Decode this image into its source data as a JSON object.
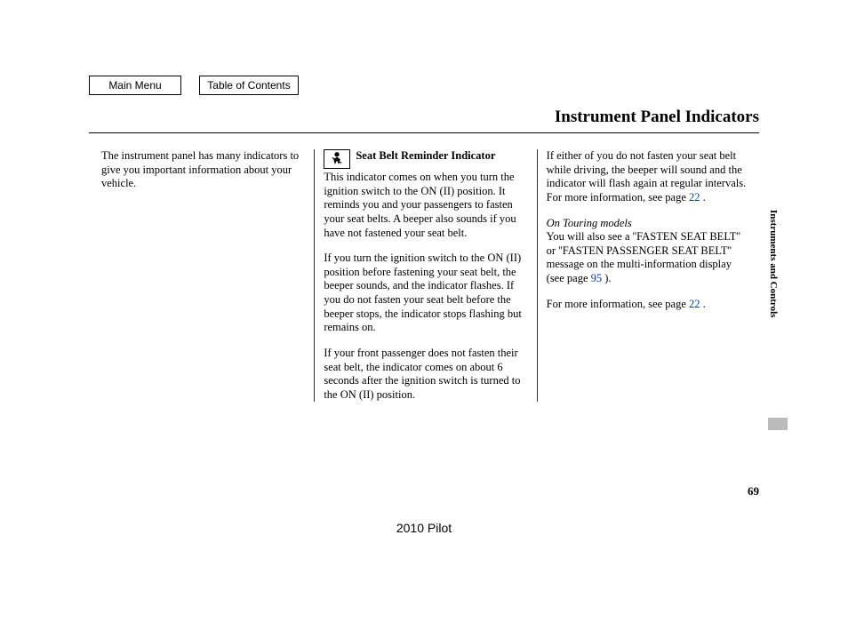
{
  "nav": {
    "main_menu": "Main Menu",
    "toc": "Table of Contents"
  },
  "page_title": "Instrument Panel Indicators",
  "side_label": "Instruments and Controls",
  "page_number": "69",
  "footer_model": "2010 Pilot",
  "col1": {
    "intro": "The instrument panel has many indicators to give you important information about your vehicle."
  },
  "col2": {
    "indicator_title": "Seat Belt Reminder Indicator",
    "p1": "This indicator comes on when you turn the ignition switch to the ON (II) position. It reminds you and your passengers to fasten your seat belts. A beeper also sounds if you have not fastened your seat belt.",
    "p2": "If you turn the ignition switch to the ON (II) position before fastening your seat belt, the beeper sounds, and the indicator flashes. If you do not fasten your seat belt before the beeper stops, the indicator stops flashing but remains on.",
    "p3": "If your front passenger does not fasten their seat belt, the indicator comes on about 6 seconds after the ignition switch is turned to the ON (II) position."
  },
  "col3": {
    "p1_a": "If either of you do not fasten your seat belt while driving, the beeper will sound and the indicator will flash again at regular intervals. For more information, see page ",
    "p1_ref": "22",
    "p1_b": " .",
    "note_title": "On Touring models",
    "p2_a": "You will also see a ''FASTEN SEAT BELT'' or ''FASTEN PASSENGER SEAT BELT'' message on the multi-information display (see page ",
    "p2_ref": "95",
    "p2_b": " ).",
    "p3_a": "For more information, see page  ",
    "p3_ref": "22",
    "p3_b": "  ."
  }
}
